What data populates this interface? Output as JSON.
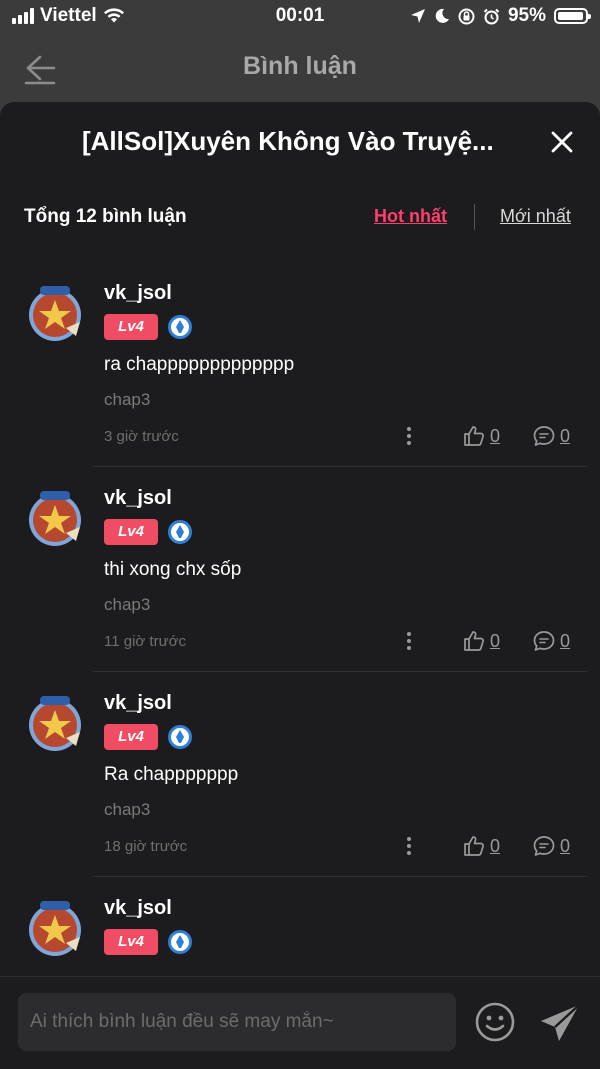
{
  "status_bar": {
    "carrier": "Viettel",
    "time": "00:01",
    "battery": "95%"
  },
  "nav": {
    "title": "Bình luận"
  },
  "sheet": {
    "title": "[AllSol]Xuyên Không Vào Truyệ..."
  },
  "summary": {
    "total": "Tổng 12 bình luận",
    "sort_hot": "Hot nhất",
    "sort_new": "Mới nhất"
  },
  "comments": [
    {
      "user": "vk_jsol",
      "level": "Lv4",
      "text": "ra chappppppppppppp",
      "chapter": "chap3",
      "time": "3 giờ trước",
      "likes": "0",
      "replies": "0"
    },
    {
      "user": "vk_jsol",
      "level": "Lv4",
      "text": "thi xong chx sốp",
      "chapter": "chap3",
      "time": "11 giờ trước",
      "likes": "0",
      "replies": "0"
    },
    {
      "user": "vk_jsol",
      "level": "Lv4",
      "text": "Ra chappppppp",
      "chapter": "chap3",
      "time": "18 giờ trước",
      "likes": "0",
      "replies": "0"
    },
    {
      "user": "vk_jsol",
      "level": "Lv4",
      "text": "",
      "chapter": "",
      "time": "",
      "likes": "",
      "replies": ""
    }
  ],
  "composer": {
    "placeholder": "Ai thích bình luận đều sẽ may mắn~"
  },
  "colors": {
    "accent": "#ff3f6c",
    "level_badge": "#f04c64",
    "sheet_bg": "#1c1c1e"
  }
}
